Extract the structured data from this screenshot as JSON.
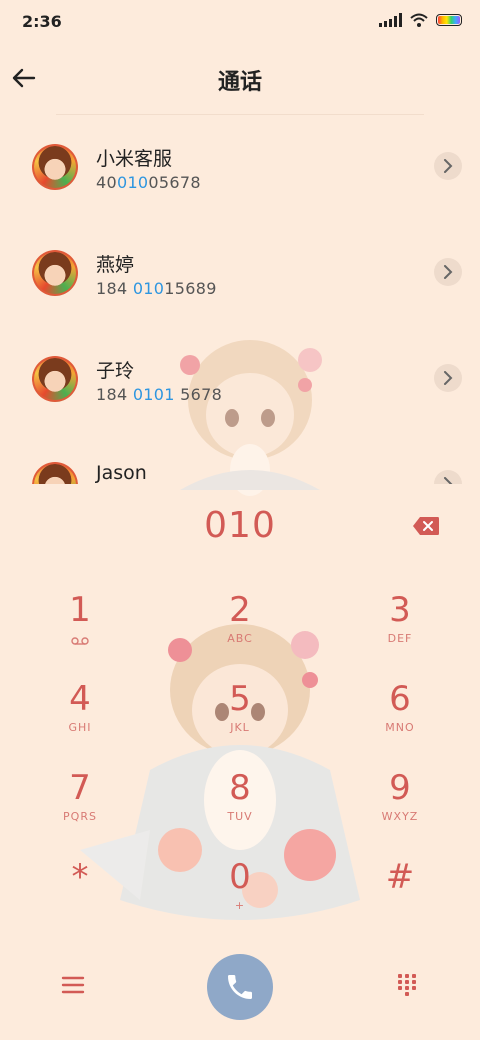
{
  "status": {
    "time": "2:36"
  },
  "header": {
    "title": "通话"
  },
  "contacts": [
    {
      "name": "小米客服",
      "num_pre": "40",
      "num_hl": "010",
      "num_post": "05678"
    },
    {
      "name": "燕婷",
      "num_pre": "184 ",
      "num_hl": "010",
      "num_post": "15689"
    },
    {
      "name": "子玲",
      "num_pre": "184 ",
      "num_hl": "0101",
      "num_post": " 5678"
    },
    {
      "name": "Jason",
      "num_pre": "",
      "num_hl": "",
      "num_post": ""
    }
  ],
  "dialer": {
    "input": "010",
    "keys": [
      {
        "num": "1",
        "sub": ""
      },
      {
        "num": "2",
        "sub": "ABC"
      },
      {
        "num": "3",
        "sub": "DEF"
      },
      {
        "num": "4",
        "sub": "GHI"
      },
      {
        "num": "5",
        "sub": "JKL"
      },
      {
        "num": "6",
        "sub": "MNO"
      },
      {
        "num": "7",
        "sub": "PQRS"
      },
      {
        "num": "8",
        "sub": "TUV"
      },
      {
        "num": "9",
        "sub": "WXYZ"
      },
      {
        "num": "*",
        "sub": ""
      },
      {
        "num": "0",
        "sub": "+"
      },
      {
        "num": "#",
        "sub": ""
      }
    ]
  },
  "colors": {
    "background": "#fdebdc",
    "accent": "#d25a55",
    "highlight": "#2e96e0",
    "call": "#8fa8c8"
  }
}
